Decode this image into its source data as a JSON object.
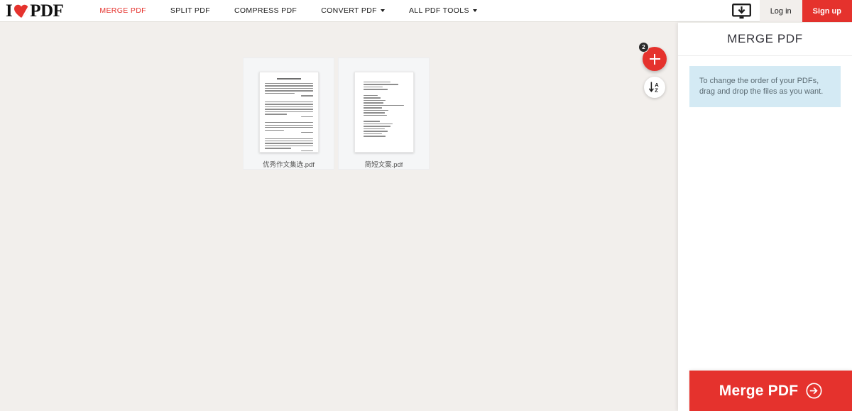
{
  "brand": {
    "logo_i": "I",
    "logo_pdf": "PDF",
    "heart_icon": "heart-icon",
    "accent_color": "#e5322d"
  },
  "topnav": {
    "links": [
      {
        "label": "MERGE PDF",
        "active": true,
        "has_caret": false
      },
      {
        "label": "SPLIT PDF",
        "active": false,
        "has_caret": false
      },
      {
        "label": "COMPRESS PDF",
        "active": false,
        "has_caret": false
      },
      {
        "label": "CONVERT PDF",
        "active": false,
        "has_caret": true
      },
      {
        "label": "ALL PDF TOOLS",
        "active": false,
        "has_caret": true
      }
    ],
    "desktop_icon": "desktop-download-icon",
    "login_label": "Log in",
    "signup_label": "Sign up"
  },
  "workspace": {
    "files": [
      {
        "name": "优秀作文集选.pdf",
        "thumb_style": "paragraphs"
      },
      {
        "name": "简短文案.pdf",
        "thumb_style": "short-lines"
      }
    ]
  },
  "fab": {
    "add_icon": "plus-icon",
    "add_badge_count": "2",
    "sort_icon": "sort-alphabetical-icon",
    "sort_letter_top": "A",
    "sort_letter_bottom": "Z"
  },
  "panel": {
    "title": "MERGE PDF",
    "info_text": "To change the order of your PDFs, drag and drop the files as you want.",
    "info_bg_color": "#d4eaf4",
    "merge_button_label": "Merge PDF",
    "merge_button_icon": "arrow-right-circle-icon"
  }
}
